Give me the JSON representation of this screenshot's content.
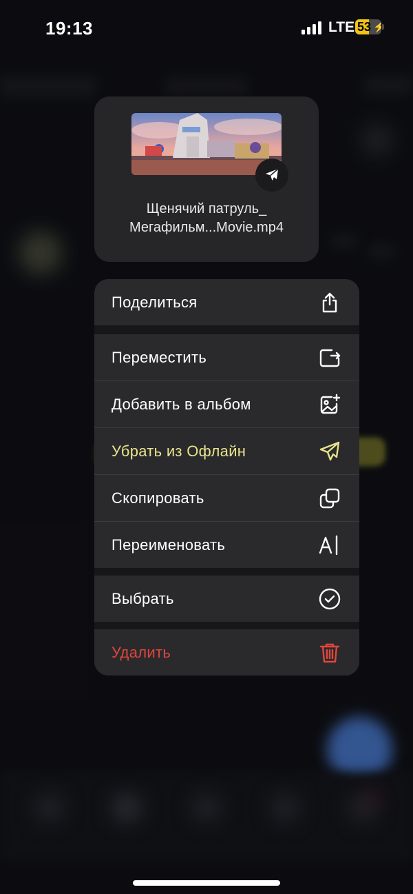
{
  "status_bar": {
    "time": "19:13",
    "network": "LTE",
    "battery": "53",
    "battery_level": 0.53
  },
  "preview": {
    "filename_line1": "Щенячий патруль_",
    "filename_line2": "Мегафильм...Movie.mp4",
    "badge_icon": "airplane-icon"
  },
  "menu": {
    "items": [
      {
        "label": "Поделиться",
        "icon": "share-icon"
      },
      {
        "label": "Переместить",
        "icon": "move-folder-icon"
      },
      {
        "label": "Добавить в альбом",
        "icon": "add-to-album-icon"
      },
      {
        "label": "Убрать из Офлайн",
        "icon": "airplane-icon",
        "color": "#e8e48c"
      },
      {
        "label": "Скопировать",
        "icon": "copy-icon"
      },
      {
        "label": "Переименовать",
        "icon": "rename-icon"
      },
      {
        "label": "Выбрать",
        "icon": "check-circle-icon"
      },
      {
        "label": "Удалить",
        "icon": "trash-icon",
        "color": "#e2453c"
      }
    ]
  },
  "colors": {
    "accent_yellow": "#f2c417",
    "danger": "#e2453c",
    "highlight": "#e8e48c"
  }
}
